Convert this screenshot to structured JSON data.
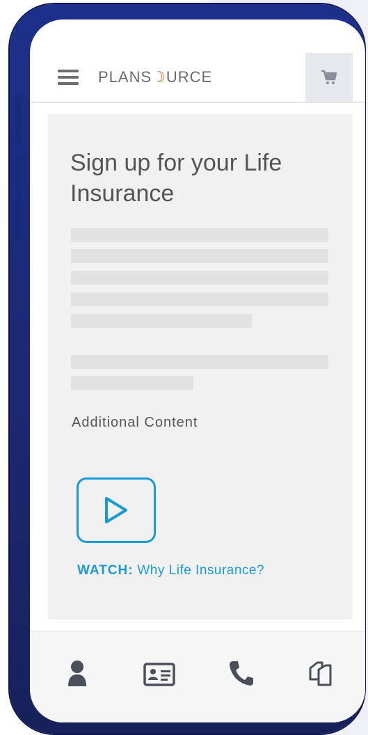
{
  "header": {
    "logo_prefix": "PLANS",
    "logo_o": "☽",
    "logo_suffix": "URCE",
    "menu_icon": "hamburger-icon",
    "cart_icon": "cart-icon"
  },
  "main": {
    "title": "Sign up for your Life Insurance",
    "additional_content": "Additional Content",
    "video": {
      "icon": "play-icon",
      "watch_prefix": "WATCH:",
      "watch_text": " Why Life Insurance?"
    }
  },
  "bottom_nav": {
    "icons": [
      "person-icon",
      "id-card-icon",
      "phone-icon",
      "copy-icon"
    ]
  },
  "colors": {
    "accent": "#1b9ad8",
    "logo_accent": "#e36f1e",
    "phone_frame": "#1c2f8a",
    "card_bg": "#f1f1f1",
    "icon_dark": "#4a4f5a"
  }
}
